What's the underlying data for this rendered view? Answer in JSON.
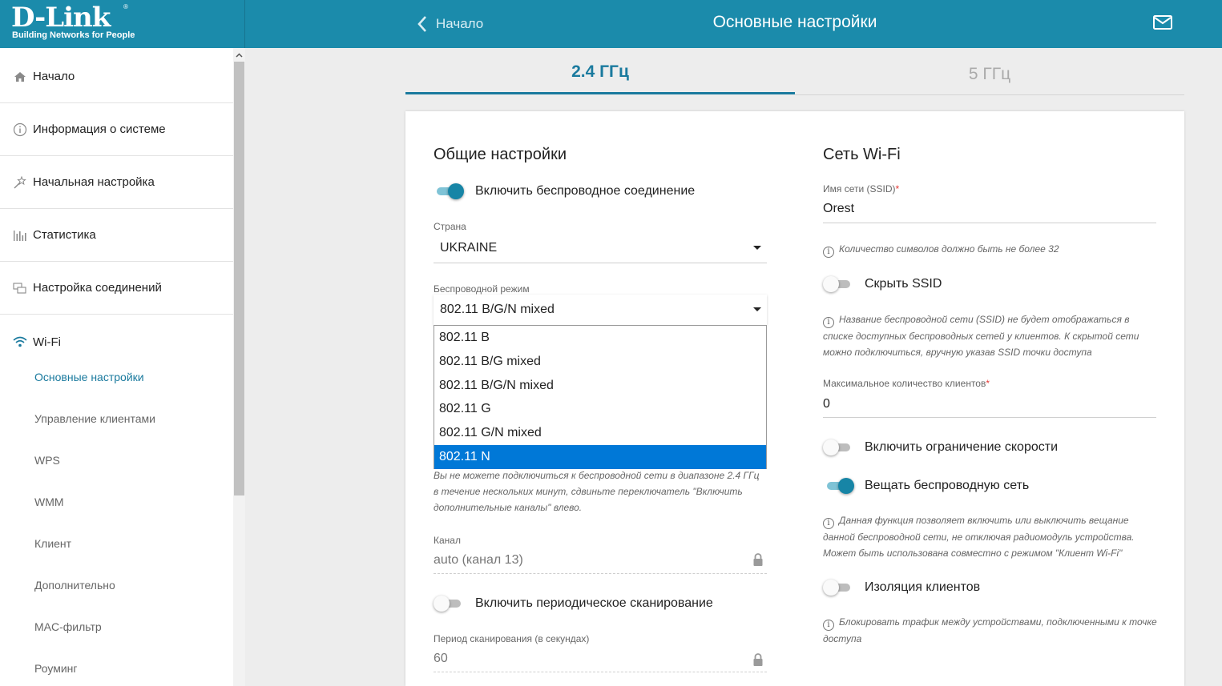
{
  "brand": {
    "name": "D-Link",
    "tm": "®",
    "tagline": "Building Networks for People"
  },
  "header": {
    "back_label": "Начало",
    "title": "Основные настройки"
  },
  "sidebar": {
    "items": [
      {
        "label": "Начало",
        "icon": "home-icon"
      },
      {
        "label": "Информация о системе",
        "icon": "info-icon"
      },
      {
        "label": "Начальная настройка",
        "icon": "wizard-icon"
      },
      {
        "label": "Статистика",
        "icon": "stats-icon"
      },
      {
        "label": "Настройка соединений",
        "icon": "connections-icon"
      },
      {
        "label": "Wi-Fi",
        "icon": "wifi-icon"
      }
    ],
    "wifi_subitems": [
      "Основные настройки",
      "Управление клиентами",
      "WPS",
      "WMM",
      "Клиент",
      "Дополнительно",
      "MAC-фильтр",
      "Роуминг"
    ]
  },
  "tabs": [
    "2.4 ГГц",
    "5 ГГц"
  ],
  "general": {
    "title": "Общие настройки",
    "enable_wireless_label": "Включить беспроводное соединение",
    "enable_wireless_on": true,
    "country_label": "Страна",
    "country_value": "UKRAINE",
    "mode_label": "Беспроводной режим",
    "mode_value": "802.11 B/G/N mixed",
    "mode_options": [
      "802.11 B",
      "802.11 B/G mixed",
      "802.11 B/G/N mixed",
      "802.11 G",
      "802.11 G/N mixed",
      "802.11 N"
    ],
    "mode_highlighted": "802.11 N",
    "channel_hint": [
      "Вы не можете подключиться к беспроводной сети в диапазоне 2.4 ГГц",
      "в течение нескольких минут, сдвиньте переключатель \"Включить",
      "дополнительные каналы\" влево."
    ],
    "channel_label": "Канал",
    "channel_value": "auto (канал 13)",
    "periodic_scan_label": "Включить периодическое сканирование",
    "periodic_scan_on": false,
    "scan_period_label": "Период сканирования (в секундах)",
    "scan_period_value": "60"
  },
  "wifi_network": {
    "title": "Сеть Wi-Fi",
    "ssid_label": "Имя сети (SSID)",
    "required_mark": "*",
    "ssid_value": "Orest",
    "ssid_hint": "Количество символов должно быть не более 32",
    "hide_ssid_label": "Скрыть SSID",
    "hide_ssid_on": false,
    "hide_ssid_hint": [
      "Название беспроводной сети (SSID) не будет отображаться в",
      "списке доступных беспроводных сетей у клиентов. К скрытой сети",
      "можно подключиться, вручную указав SSID точки доступа"
    ],
    "max_clients_label": "Максимальное количество клиентов",
    "max_clients_value": "0",
    "speed_limit_label": "Включить ограничение скорости",
    "speed_limit_on": false,
    "broadcast_label": "Вещать беспроводную сеть",
    "broadcast_on": true,
    "broadcast_hint": [
      "Данная функция позволяет включить или выключить вещание",
      "данной беспроводной сети, не отключая радиомодуль устройства.",
      "Может быть использована совместно с режимом \"Клиент Wi-Fi\""
    ],
    "isolation_label": "Изоляция клиентов",
    "isolation_on": false,
    "isolation_hint": [
      "Блокировать трафик между устройствами, подключенными к точке",
      "доступа"
    ]
  },
  "colors": {
    "brand": "#1b8bab",
    "accent": "#1a7a9e",
    "selection": "#0078d7"
  }
}
